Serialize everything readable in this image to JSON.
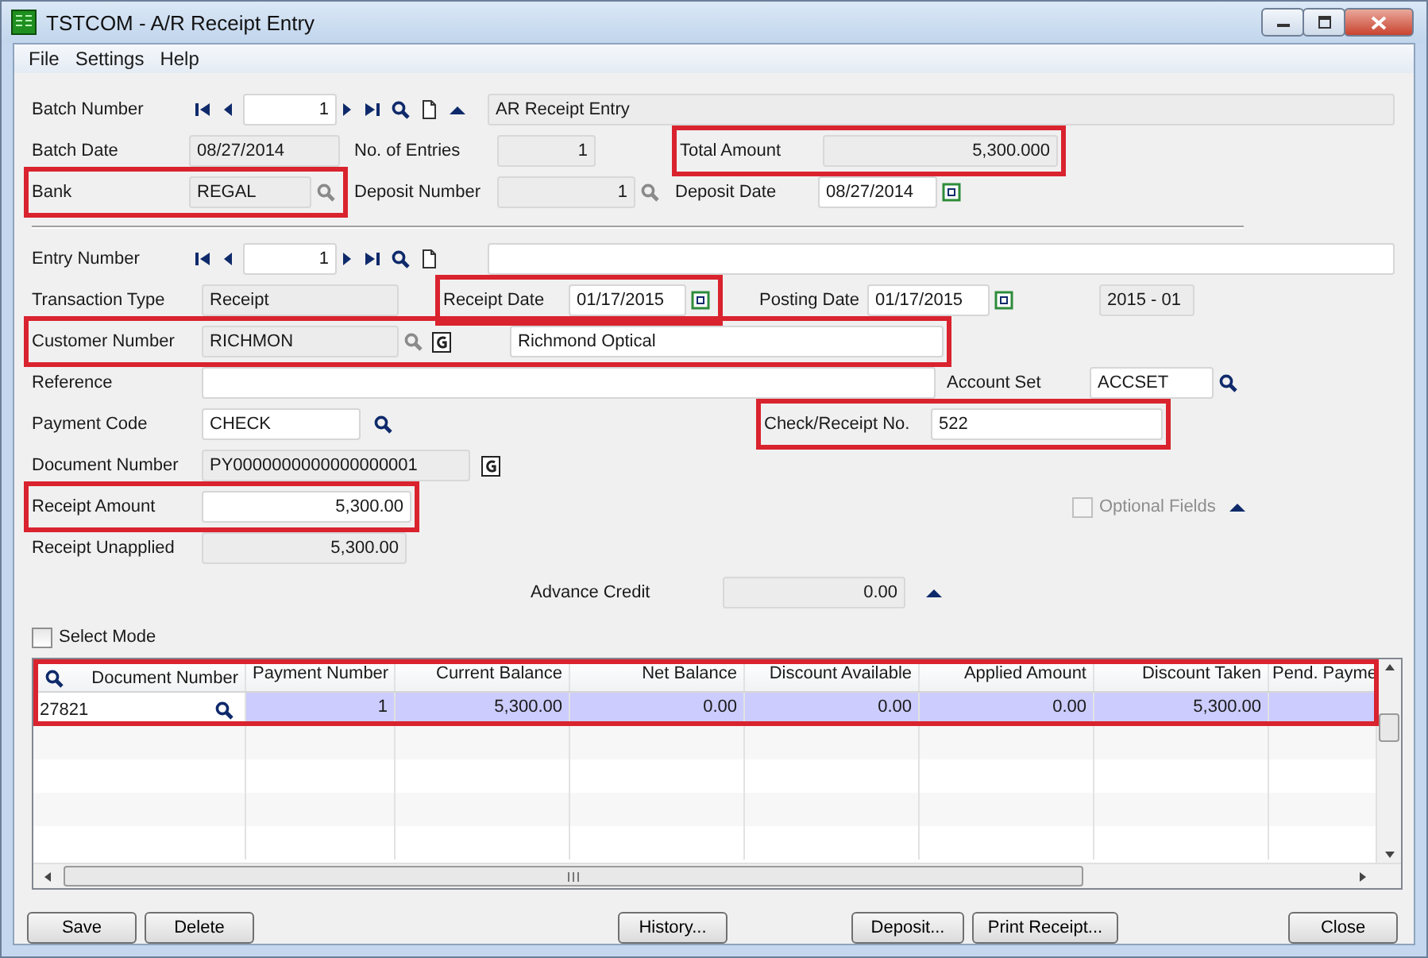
{
  "window": {
    "title": "TSTCOM - A/R Receipt Entry"
  },
  "menu": [
    {
      "label": "File"
    },
    {
      "label": "Settings"
    },
    {
      "label": "Help"
    }
  ],
  "batch_number": {
    "label": "Batch Number",
    "value": "1",
    "description": "AR Receipt Entry"
  },
  "batch_date": {
    "label": "Batch Date",
    "value": "08/27/2014"
  },
  "no_of_entries": {
    "label": "No. of Entries",
    "value": "1"
  },
  "total_amount": {
    "label": "Total Amount",
    "value": "5,300.000",
    "highlighted": true
  },
  "bank": {
    "label": "Bank",
    "value": "REGAL",
    "highlighted": true
  },
  "deposit_number": {
    "label": "Deposit Number",
    "value": "1"
  },
  "deposit_date": {
    "label": "Deposit Date",
    "value": "08/27/2014"
  },
  "entry_number": {
    "label": "Entry Number",
    "value": "1"
  },
  "transaction_type": {
    "label": "Transaction Type",
    "value": "Receipt"
  },
  "receipt_date": {
    "label": "Receipt Date",
    "value": "01/17/2015",
    "highlighted": true
  },
  "posting_date": {
    "label": "Posting Date",
    "value": "01/17/2015"
  },
  "fiscal_period": {
    "value": "2015 - 01"
  },
  "customer_number": {
    "label": "Customer Number",
    "value": "RICHMON",
    "name": "Richmond Optical",
    "highlighted": true
  },
  "reference": {
    "label": "Reference"
  },
  "account_set": {
    "label": "Account Set",
    "value": "ACCSET"
  },
  "payment_code": {
    "label": "Payment Code",
    "value": "CHECK"
  },
  "check_receipt_no": {
    "label": "Check/Receipt No.",
    "value": "522",
    "highlighted": true
  },
  "document_number": {
    "label": "Document Number",
    "value": "PY0000000000000000001"
  },
  "receipt_amount": {
    "label": "Receipt Amount",
    "value": "5,300.00",
    "highlighted": true
  },
  "optional_fields": {
    "label": "Optional Fields",
    "checked": false,
    "disabled": true
  },
  "receipt_unapplied": {
    "label": "Receipt Unapplied",
    "value": "5,300.00"
  },
  "advance_credit": {
    "label": "Advance Credit",
    "value": "0.00"
  },
  "select_mode": {
    "label": "Select Mode",
    "checked": false
  },
  "grid": {
    "highlighted": true,
    "columns": [
      "Document Number",
      "Payment Number",
      "Current Balance",
      "Net Balance",
      "Discount Available",
      "Applied Amount",
      "Discount Taken",
      "Pend. Payme"
    ],
    "rows": [
      {
        "selected": true,
        "cells": [
          "27821",
          "1",
          "5,300.00",
          "0.00",
          "0.00",
          "0.00",
          "5,300.00"
        ]
      }
    ]
  },
  "buttons": [
    [
      {
        "label": "Save"
      },
      {
        "label": "Delete"
      }
    ],
    [
      {
        "label": "History..."
      }
    ],
    [
      {
        "label": "Deposit..."
      },
      {
        "label": "Print Receipt..."
      }
    ],
    [
      {
        "label": "Close"
      }
    ]
  ]
}
